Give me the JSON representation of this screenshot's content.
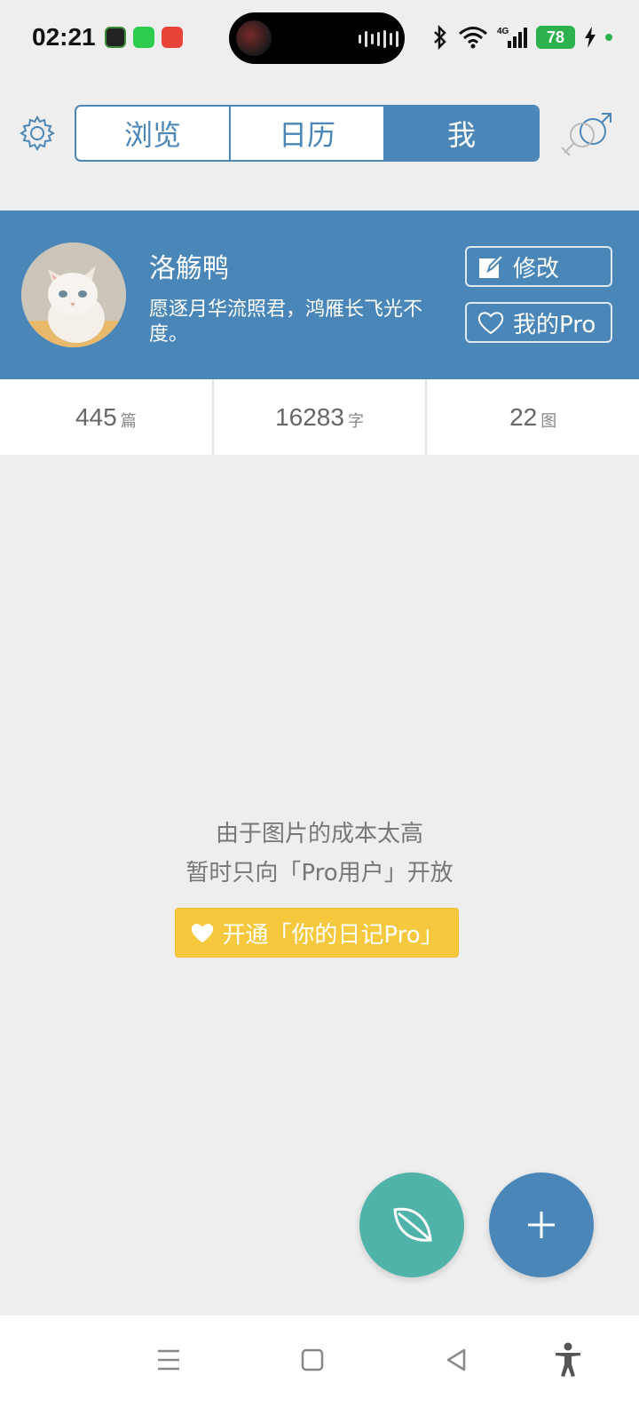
{
  "status_bar": {
    "time": "02:21",
    "battery": "78",
    "network": "4G"
  },
  "nav": {
    "tabs": [
      {
        "label": "浏览"
      },
      {
        "label": "日历"
      },
      {
        "label": "我"
      }
    ],
    "active_tab": "我"
  },
  "profile": {
    "name": "洛觞鸭",
    "bio": "愿逐月华流照君，鸿雁长飞光不度。",
    "edit_label": "修改",
    "pro_label": "我的Pro"
  },
  "stats": [
    {
      "value": "445",
      "unit": "篇"
    },
    {
      "value": "16283",
      "unit": "字"
    },
    {
      "value": "22",
      "unit": "图"
    }
  ],
  "empty_message": {
    "line1": "由于图片的成本太高",
    "line2": "暂时只向「Pro用户」开放",
    "cta_label": "开通「你的日记Pro」"
  },
  "colors": {
    "accent": "#4a87b8",
    "leaf_fab": "#4fb3a9",
    "cta": "#f6c83e",
    "background": "#eeeeee"
  },
  "icons": [
    "gear-icon",
    "gender-icon",
    "edit-icon",
    "heart-icon",
    "leaf-icon",
    "plus-icon",
    "menu-icon",
    "home-icon",
    "back-icon",
    "accessibility-icon"
  ]
}
